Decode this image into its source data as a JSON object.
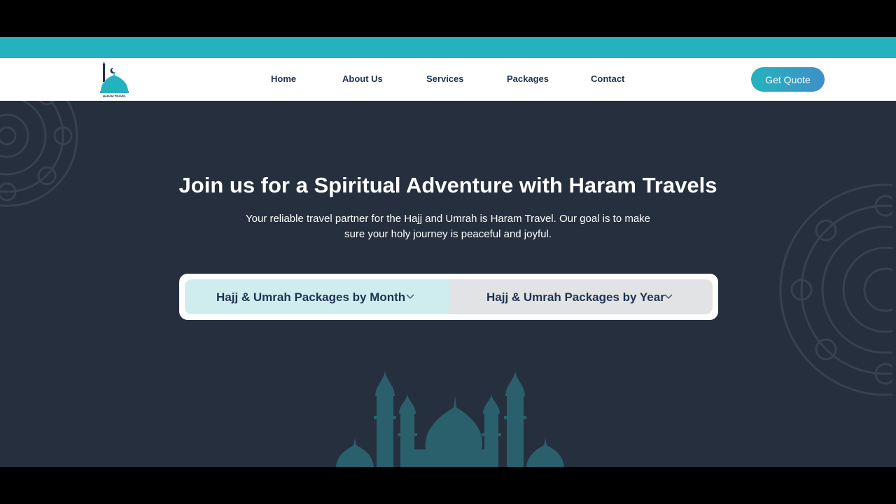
{
  "brand": {
    "logo_text": "HARAM TRAVEL",
    "accent_color": "#24b3be",
    "dark_bg": "#262f3d",
    "nav_text_color": "#1f3350"
  },
  "nav": {
    "items": [
      {
        "label": "Home"
      },
      {
        "label": "About Us"
      },
      {
        "label": "Services"
      },
      {
        "label": "Packages"
      },
      {
        "label": "Contact"
      }
    ],
    "cta_label": "Get Quote"
  },
  "hero": {
    "title": "Join us for a Spiritual Adventure with Haram Travels",
    "subtitle": "Your reliable travel partner for the Hajj and Umrah is Haram Travel. Our goal is to make sure your holy journey is peaceful and joyful.",
    "selectors": [
      {
        "label": "Hajj & Umrah Packages by Month",
        "icon": "chevron-down-icon"
      },
      {
        "label": "Hajj & Umrah Packages by Year",
        "icon": "chevron-down-icon"
      }
    ]
  }
}
